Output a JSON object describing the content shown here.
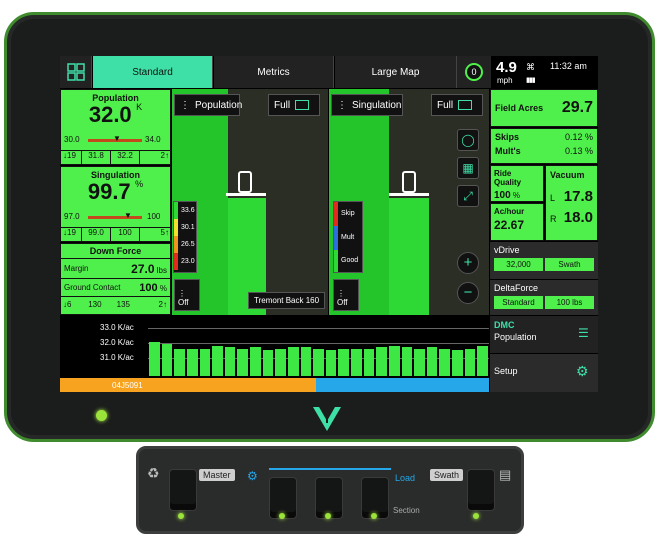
{
  "tabs": [
    {
      "label": "Standard"
    },
    {
      "label": "Metrics"
    },
    {
      "label": "Large Map"
    }
  ],
  "gps": {
    "badge": "0"
  },
  "status": {
    "speed": "4.9",
    "speed_unit": "mph",
    "time": "11:32 am"
  },
  "population": {
    "title": "Population",
    "value": "32.0",
    "unit": "K",
    "min": "30.0",
    "max": "34.0",
    "row": [
      "31.8",
      "32.2"
    ],
    "row_left": "19",
    "row_right": "2"
  },
  "singulation": {
    "title": "Singulation",
    "value": "99.7",
    "unit": "%",
    "min": "97.0",
    "max": "100",
    "row": [
      "99.0",
      "100"
    ],
    "row_left": "19",
    "row_right": "5"
  },
  "down_force": {
    "title": "Down Force",
    "margin_label": "Margin",
    "margin_value": "27.0",
    "margin_unit": "lbs",
    "gc_label": "Ground Contact",
    "gc_value": "100",
    "gc_unit": "%",
    "row": [
      "6",
      "130",
      "135",
      "2"
    ]
  },
  "map_left": {
    "button": "Population",
    "full": "Full",
    "legend": [
      "33.6",
      "30.1",
      "26.5",
      "23.0"
    ],
    "off": "Off",
    "tooltip": "Tremont Back 160"
  },
  "map_right": {
    "button": "Singulation",
    "full": "Full",
    "legend": [
      "Skip",
      "Mult",
      "Good"
    ],
    "off": "Off"
  },
  "field": {
    "label": "Field Acres",
    "value": "29.7"
  },
  "skips": {
    "label": "Skips",
    "value": "0.12",
    "unit": "%",
    "mults_label": "Mult's",
    "mults_value": "0.13",
    "mults_unit": "%"
  },
  "ride": {
    "label": "Ride Quality",
    "value": "100",
    "unit": "%",
    "ach_label": "Ac/hour",
    "ach_value": "22.67"
  },
  "vacuum": {
    "label": "Vacuum",
    "l_label": "L",
    "l_value": "17.8",
    "r_label": "R",
    "r_value": "18.0"
  },
  "vdrive": {
    "label": "vDrive",
    "value": "32,000",
    "mode": "Swath"
  },
  "deltaforce": {
    "label": "DeltaForce",
    "mode": "Standard",
    "value": "100 lbs"
  },
  "dmc": {
    "label": "DMC",
    "sub": "Population"
  },
  "setup": {
    "label": "Setup"
  },
  "rowchart": {
    "ticks": [
      "33.0 K/ac",
      "32.0 K/ac",
      "31.0 K/ac"
    ],
    "ymin": 30.0,
    "ymax": 33.5,
    "values": [
      32.1,
      32.0,
      31.7,
      31.7,
      31.7,
      31.9,
      31.8,
      31.7,
      31.8,
      31.6,
      31.7,
      31.8,
      31.8,
      31.7,
      31.6,
      31.7,
      31.7,
      31.7,
      31.8,
      31.9,
      31.8,
      31.7,
      31.8,
      31.7,
      31.6,
      31.7,
      31.9
    ],
    "bottom_label": "04J5091"
  },
  "console": {
    "master": "Master",
    "load": "Load",
    "swath": "Swath",
    "section": "Section"
  },
  "colors": {
    "green": "#4ff04b",
    "teal": "#3ee0a8",
    "bezel_green": "#3f8b2e",
    "orange": "#f7a31f",
    "blue": "#25a7e9"
  }
}
